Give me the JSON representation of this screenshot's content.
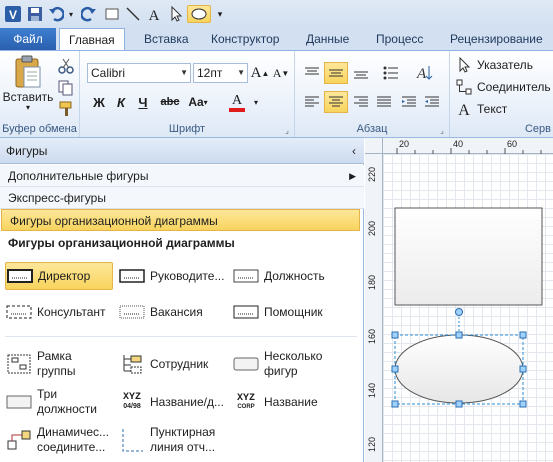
{
  "tabs": {
    "file": "Файл",
    "home": "Главная",
    "insert": "Вставка",
    "design": "Конструктор",
    "data": "Данные",
    "process": "Процесс",
    "review": "Рецензирование"
  },
  "ribbon": {
    "clipboard": {
      "paste": "Вставить",
      "label": "Буфер обмена"
    },
    "font": {
      "family": "Calibri",
      "size": "12пт",
      "label": "Шрифт"
    },
    "paragraph": {
      "label": "Абзац"
    },
    "tools": {
      "pointer": "Указатель",
      "connector": "Соединитель",
      "text": "Текст",
      "label": "Серв"
    }
  },
  "pane": {
    "title": "Фигуры",
    "more_shapes": "Дополнительные фигуры",
    "quick_shapes": "Экспресс-фигуры",
    "org_chart_stencil": "Фигуры организационной диаграммы",
    "stencil_heading": "Фигуры организационной диаграммы",
    "shapes": [
      {
        "label": "Директор"
      },
      {
        "label": "Руководите..."
      },
      {
        "label": "Должность"
      },
      {
        "label": "Консультант"
      },
      {
        "label": "Вакансия"
      },
      {
        "label": "Помощник"
      },
      {
        "line1": "Рамка",
        "line2": "группы"
      },
      {
        "label": "Сотрудник"
      },
      {
        "line1": "Несколько",
        "line2": "фигур"
      },
      {
        "line1": "Три",
        "line2": "должности"
      },
      {
        "label": "Название/д..."
      },
      {
        "label": "Название"
      },
      {
        "line1": "Динамичес...",
        "line2": "соедините..."
      },
      {
        "line1": "Пунктирная",
        "line2": "линия отч..."
      }
    ],
    "icon_text": {
      "xyz": "XYZ",
      "date": "04/98",
      "corp": "CORP"
    }
  },
  "ruler": {
    "top": [
      "20",
      "40",
      "60"
    ],
    "left": [
      "220",
      "200",
      "180",
      "160",
      "140",
      "120"
    ]
  },
  "colors": {
    "accent": "#2a5fae",
    "selected": "#f8d45d",
    "font_color": "#e01b1b"
  }
}
